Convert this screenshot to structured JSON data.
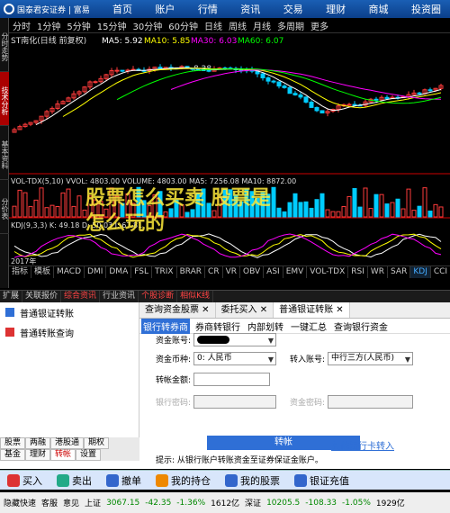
{
  "app": {
    "brand": "国泰君安证券 | 富易",
    "menu": [
      "首页",
      "账户",
      "行情",
      "资讯",
      "交易",
      "理财",
      "商城",
      "投资圈"
    ]
  },
  "left_tabs": [
    "分时走势",
    "技术分析",
    "基本资料",
    "分价表"
  ],
  "periods": [
    "分时",
    "1分钟",
    "5分钟",
    "15分钟",
    "30分钟",
    "60分钟",
    "日线",
    "周线",
    "月线",
    "多周期",
    "更多"
  ],
  "chart": {
    "title": "ST南化(日线 前复权)",
    "ma": [
      {
        "label": "MA5: 5.92",
        "color": "#ffffff"
      },
      {
        "label": "MA10: 5.85",
        "color": "#ffff00"
      },
      {
        "label": "MA30: 6.03",
        "color": "#ff00ff"
      },
      {
        "label": "MA60: 6.07",
        "color": "#00ff00"
      }
    ],
    "price_label": "8.28",
    "volume_header": "VOL-TDX(5,10)  VVOL: 4803.00  VOLUME: 4803.00  MA5: 7256.08  MA10: 8872.00",
    "kdj_header": "KDJ(9,3,3)  K: 49.18  D: 50.03  J: 67.81",
    "year": "2017年"
  },
  "watermark": {
    "line1": "股票怎么买卖 股票是",
    "line2": "怎么玩的"
  },
  "indicator_tabs": [
    "指标",
    "模板",
    "MACD",
    "DMI",
    "DMA",
    "FSL",
    "TRIX",
    "BRAR",
    "CR",
    "VR",
    "OBV",
    "ASI",
    "EMV",
    "VOL-TDX",
    "RSI",
    "WR",
    "SAR",
    "KDJ",
    "CCI"
  ],
  "active_indicator": "KDJ",
  "func_tabs": [
    "扩展",
    "关联报价",
    "综合资讯",
    "行业资讯",
    "个股诊断",
    "相似K线"
  ],
  "sidebar": {
    "items": [
      {
        "label": "普通银证转账",
        "icon": "transfer-icon"
      },
      {
        "label": "普通转账查询",
        "icon": "query-icon"
      }
    ]
  },
  "doc_tabs": [
    "查询资金股票",
    "委托买入",
    "普通银证转账"
  ],
  "sub_tabs": [
    "银行转券商",
    "券商转银行",
    "内部划转",
    "一键汇总",
    "查询银行资金"
  ],
  "form": {
    "account_label": "资金账号:",
    "currency_label": "资金币种:",
    "currency_value": "0: 人民币",
    "in_account_label": "转入账号:",
    "in_account_value": "中行三方(人民币)",
    "amount_label": "转帐金额:",
    "bank_pwd_label": "银行密码:",
    "fund_pwd_label": "资金密码:",
    "submit_label": "转帐",
    "other_link": "其他银行卡转入",
    "notice": "提示: 从银行账户转账资金至证券保证金账户。"
  },
  "bottom_tabs": {
    "row1": [
      "股票",
      "两融",
      "港股通",
      "期权"
    ],
    "row2": [
      "基金",
      "理财",
      "转帐",
      "设置"
    ],
    "active": "转帐"
  },
  "actions": [
    {
      "label": "买入",
      "icon": "buy-icon",
      "color": "#d33"
    },
    {
      "label": "卖出",
      "icon": "sell-icon",
      "color": "#2a8"
    },
    {
      "label": "撤单",
      "icon": "cancel-order-icon",
      "color": "#36c"
    },
    {
      "label": "我的持仓",
      "icon": "holdings-icon",
      "color": "#e80"
    },
    {
      "label": "我的股票",
      "icon": "my-stocks-icon",
      "color": "#36c"
    },
    {
      "label": "银证充值",
      "icon": "deposit-icon",
      "color": "#36c"
    }
  ],
  "status": {
    "hide_shortcut": "隐藏快速",
    "service": "客服",
    "feedback": "意见",
    "sh_label": "上证",
    "sh_value": "3067.15",
    "sh_change": "-42.35",
    "sh_pct": "-1.36%",
    "sh_amount": "1612亿",
    "sz_label": "深证",
    "sz_value": "10205.5",
    "sz_change": "-108.33",
    "sz_pct": "-1.05%",
    "sz_amount": "1929亿"
  },
  "colors": {
    "up": "#ff3b3b",
    "down": "#00ccff",
    "accent": "#2f6fd6"
  }
}
